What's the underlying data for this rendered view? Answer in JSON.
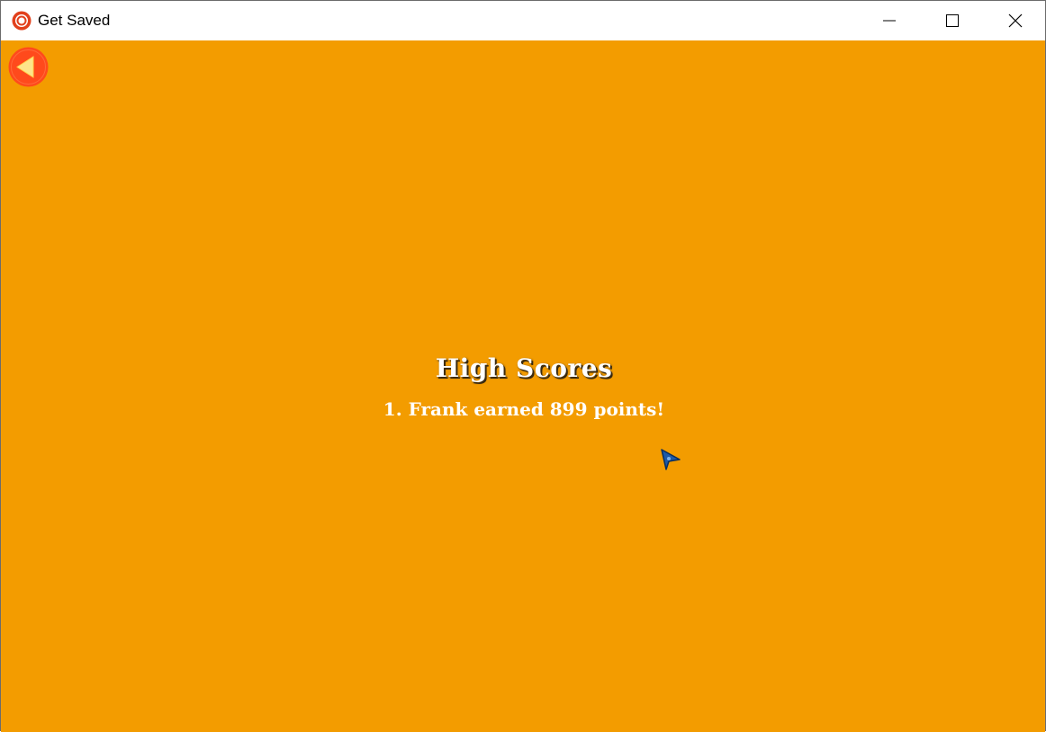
{
  "window": {
    "title": "Get Saved",
    "icon": "app-logo-icon",
    "controls": [
      "minimize-icon",
      "maximize-icon",
      "close-icon"
    ]
  },
  "game": {
    "background_color": "#f39c00",
    "back_button": {
      "icon": "back-arrow-icon",
      "color": "#ff4a1c"
    },
    "high_scores": {
      "title": "High Scores",
      "entries": [
        {
          "text": "1. Frank earned 899 points!"
        }
      ]
    },
    "cursor": {
      "icon": "pointer-cursor-icon",
      "color": "#1e5aa8"
    }
  }
}
